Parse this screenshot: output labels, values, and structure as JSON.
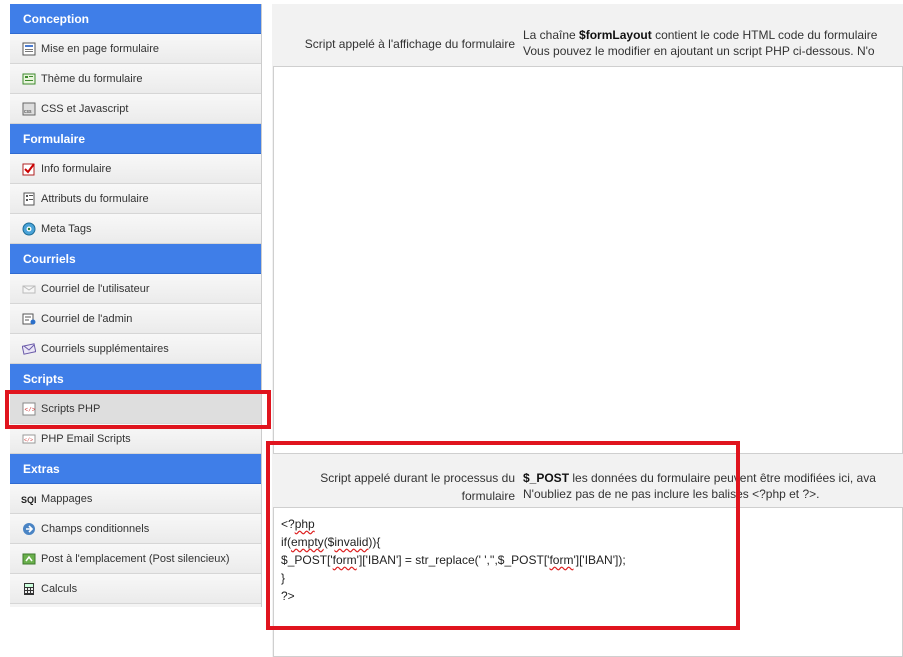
{
  "sidebar": {
    "sections": [
      {
        "title": "Conception",
        "items": [
          {
            "label": "Mise en page formulaire",
            "icon": "layout-icon"
          },
          {
            "label": "Thème du formulaire",
            "icon": "theme-icon"
          },
          {
            "label": "CSS et Javascript",
            "icon": "css-icon"
          }
        ]
      },
      {
        "title": "Formulaire",
        "items": [
          {
            "label": "Info formulaire",
            "icon": "form-edit-icon"
          },
          {
            "label": "Attributs du formulaire",
            "icon": "attributes-icon"
          },
          {
            "label": "Meta Tags",
            "icon": "meta-tags-icon"
          }
        ]
      },
      {
        "title": "Courriels",
        "items": [
          {
            "label": "Courriel de l'utilisateur",
            "icon": "user-mail-icon"
          },
          {
            "label": "Courriel de l'admin",
            "icon": "admin-mail-icon"
          },
          {
            "label": "Courriels supplémentaires",
            "icon": "extra-mail-icon"
          }
        ]
      },
      {
        "title": "Scripts",
        "items": [
          {
            "label": "Scripts PHP",
            "icon": "php-script-icon",
            "active": true
          },
          {
            "label": "PHP Email Scripts",
            "icon": "php-email-icon"
          }
        ]
      },
      {
        "title": "Extras",
        "items": [
          {
            "label": "Mappages",
            "icon": "sql-icon"
          },
          {
            "label": "Champs conditionnels",
            "icon": "conditional-icon"
          },
          {
            "label": "Post à l'emplacement (Post silencieux)",
            "icon": "silent-post-icon"
          },
          {
            "label": "Calculs",
            "icon": "calculator-icon"
          }
        ]
      }
    ]
  },
  "display_script": {
    "label": "Script appelé à l'affichage du formulaire",
    "desc_line1_prefix": "La chaîne ",
    "desc_line1_bold": "$formLayout",
    "desc_line1_suffix": " contient le code HTML code du formulaire",
    "desc_line2": "Vous pouvez le modifier en ajoutant un script PHP ci-dessous. N'o",
    "code": ""
  },
  "process_script": {
    "label_line1": "Script appelé durant le processus du",
    "label_line2": "formulaire",
    "desc_line1_bold": "$_POST",
    "desc_line1_suffix": " les données du formulaire peuvent être modifiées ici, ava",
    "desc_line2": "N'oubliez pas de ne pas inclure les balises <?php et ?>.",
    "code_lines": [
      "<?php",
      "if(empty($invalid)){",
      "$_POST['form']['IBAN'] = str_replace(' ','',$_POST['form']['IBAN']);",
      "}",
      "?>"
    ]
  },
  "colors": {
    "section_header": "#3f7ee8",
    "highlight": "#e0141e"
  }
}
